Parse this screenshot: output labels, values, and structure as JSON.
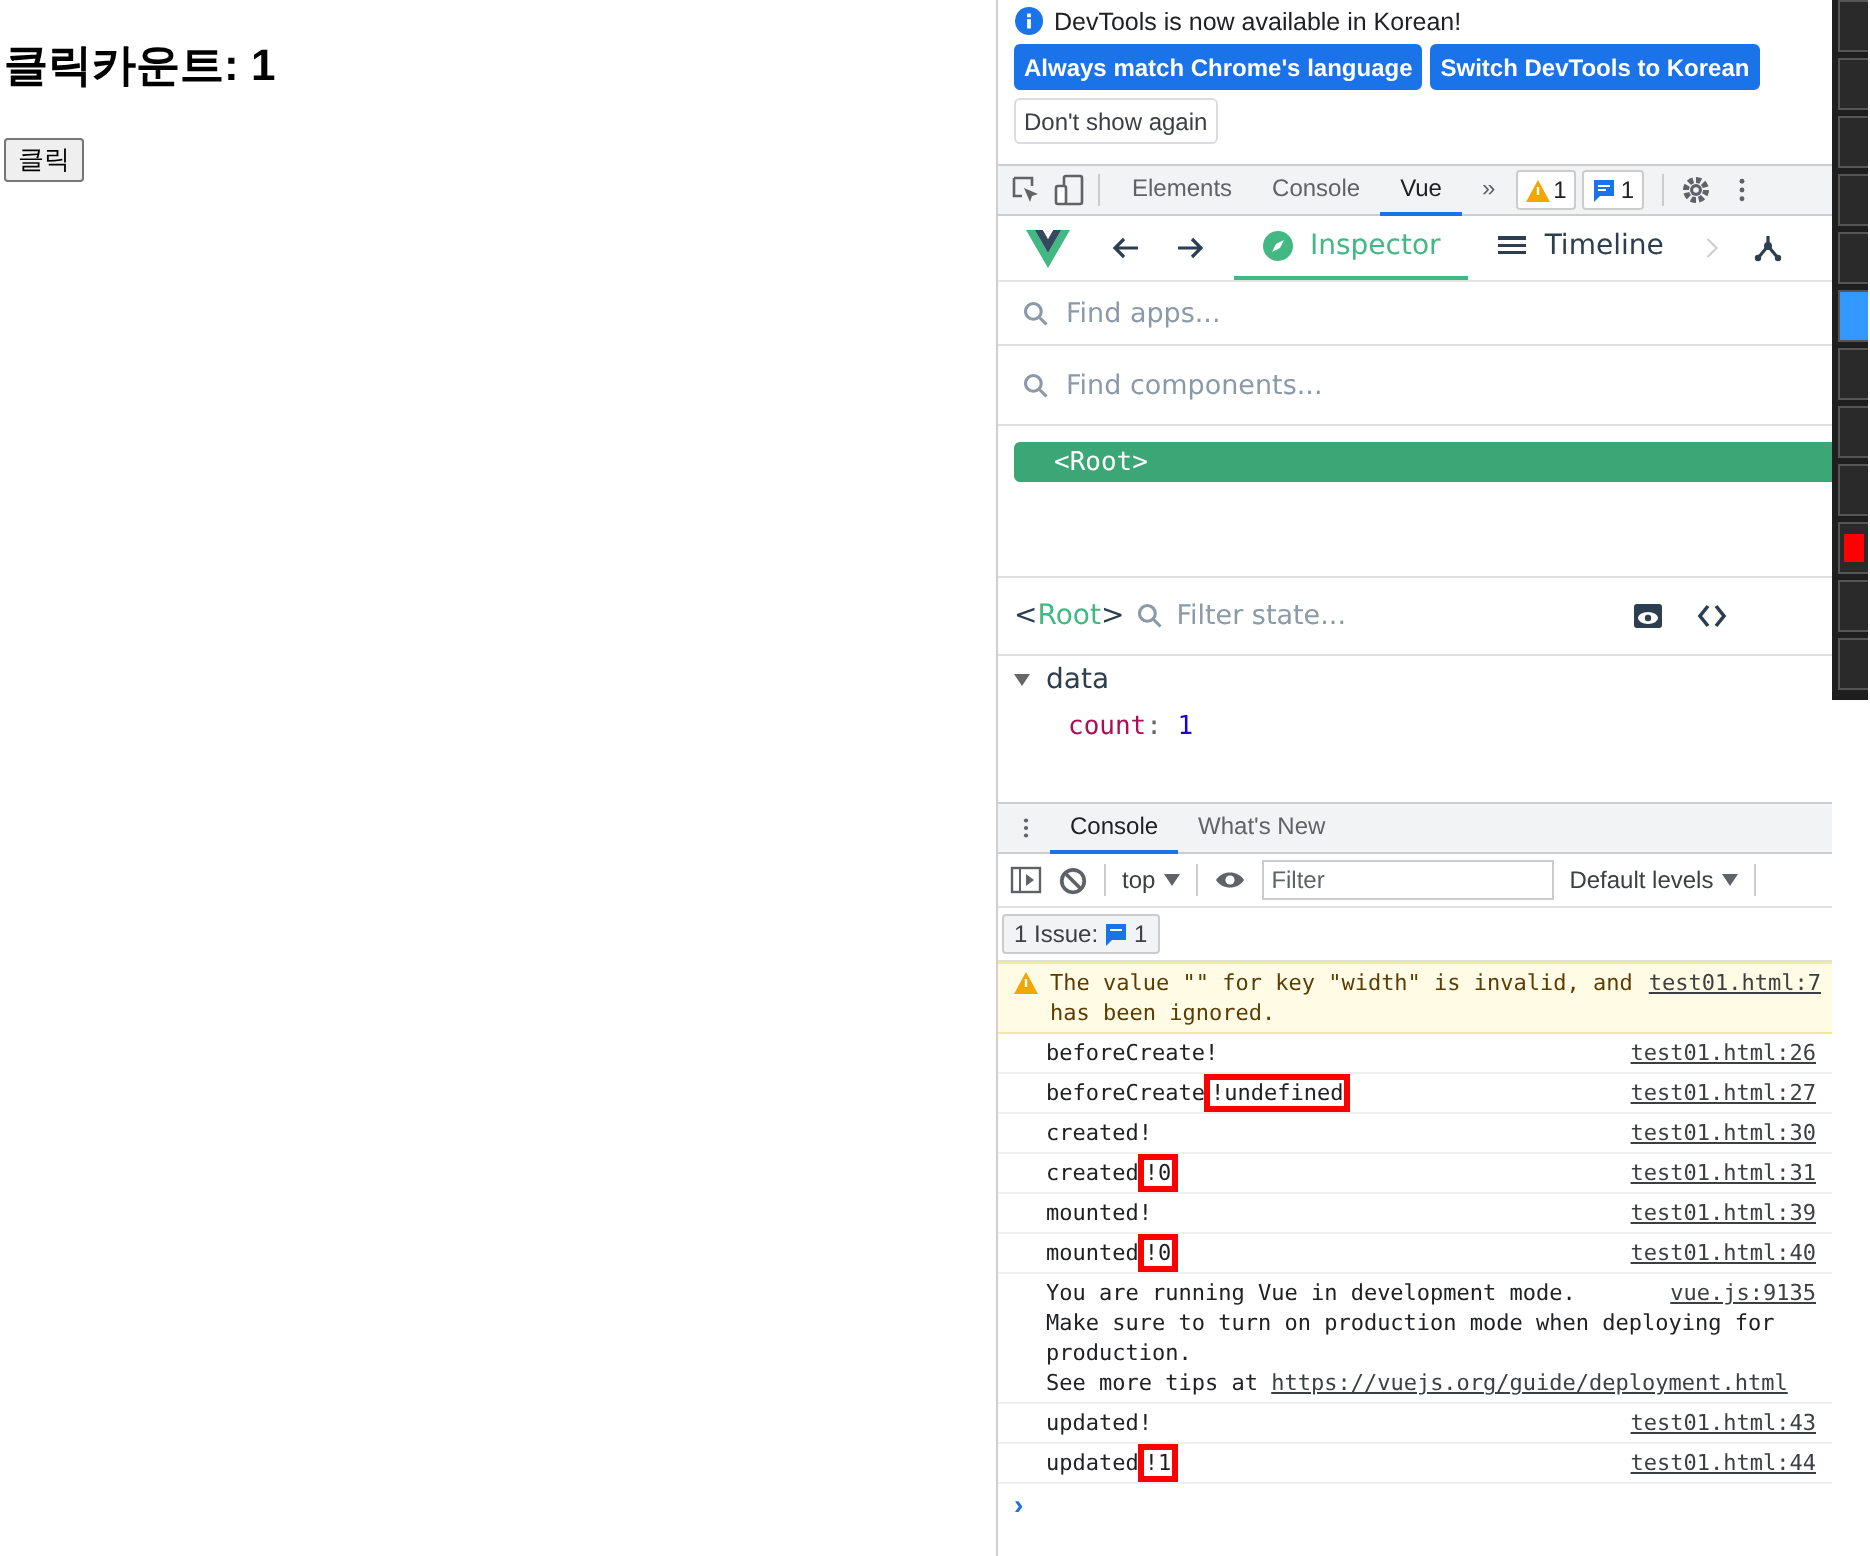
{
  "page": {
    "heading": "클릭카운트: 1",
    "button": "클릭"
  },
  "infobar": {
    "message": "DevTools is now available in Korean!",
    "buttons": [
      {
        "label": "Always match Chrome's language",
        "kind": "primary"
      },
      {
        "label": "Switch DevTools to Korean",
        "kind": "primary"
      },
      {
        "label": "Don't show again",
        "kind": "secondary"
      }
    ]
  },
  "devtools_tabs": [
    {
      "label": "Elements",
      "selected": false
    },
    {
      "label": "Console",
      "selected": false
    },
    {
      "label": "Vue",
      "selected": true
    }
  ],
  "overflow": "»",
  "counters": [
    {
      "kind": "warning",
      "count": "1"
    },
    {
      "kind": "info",
      "count": "1"
    }
  ],
  "vue_tabs": [
    {
      "label": "Inspector",
      "kind": "inspector",
      "selected": true
    },
    {
      "label": "Timeline",
      "kind": "timeline",
      "selected": false
    }
  ],
  "find_apps": {
    "placeholder": "Find apps..."
  },
  "find_components": {
    "placeholder": "Find components..."
  },
  "tree": [
    {
      "label": "<Root>",
      "selected": true
    }
  ],
  "state": {
    "lt": "<",
    "component": "Root",
    "gt": ">",
    "filter_placeholder": "Filter state...",
    "section": "data",
    "expanded": true,
    "props": [
      {
        "key": "count",
        "sep": ":",
        "value": "1"
      }
    ]
  },
  "drawer_tabs": [
    {
      "label": "Console",
      "selected": true
    },
    {
      "label": "What's New",
      "selected": false
    }
  ],
  "console_toolbar": {
    "context": "top",
    "filter_placeholder": "Filter",
    "levels": "Default levels"
  },
  "issues": {
    "label": "1 Issue:",
    "count": "1"
  },
  "messages": [
    {
      "kind": "warning",
      "lines": [
        "The value \"\" for key \"width\" is invalid, and",
        "has been ignored."
      ],
      "source": "test01.html:7"
    },
    {
      "kind": "log",
      "lines": [
        "beforeCreate!"
      ],
      "source": "test01.html:26"
    },
    {
      "kind": "log",
      "lines": [
        "beforeCreate"
      ],
      "highlight": "!undefined",
      "source": "test01.html:27"
    },
    {
      "kind": "log",
      "lines": [
        "created!"
      ],
      "source": "test01.html:30"
    },
    {
      "kind": "log",
      "lines": [
        "created"
      ],
      "highlight": "!0",
      "source": "test01.html:31"
    },
    {
      "kind": "log",
      "lines": [
        "mounted!"
      ],
      "source": "test01.html:39"
    },
    {
      "kind": "log",
      "lines": [
        "mounted"
      ],
      "highlight": "!0",
      "source": "test01.html:40"
    },
    {
      "kind": "log",
      "lines": [
        "You are running Vue in development mode.",
        "Make sure to turn on production mode when deploying for",
        "production.",
        "See more tips at "
      ],
      "link": "https://vuejs.org/guide/deployment.html",
      "source": "vue.js:9135"
    },
    {
      "kind": "log",
      "lines": [
        "updated!"
      ],
      "source": "test01.html:43"
    },
    {
      "kind": "log",
      "lines": [
        "updated"
      ],
      "highlight": "!1",
      "source": "test01.html:44"
    }
  ],
  "prompt": "›"
}
